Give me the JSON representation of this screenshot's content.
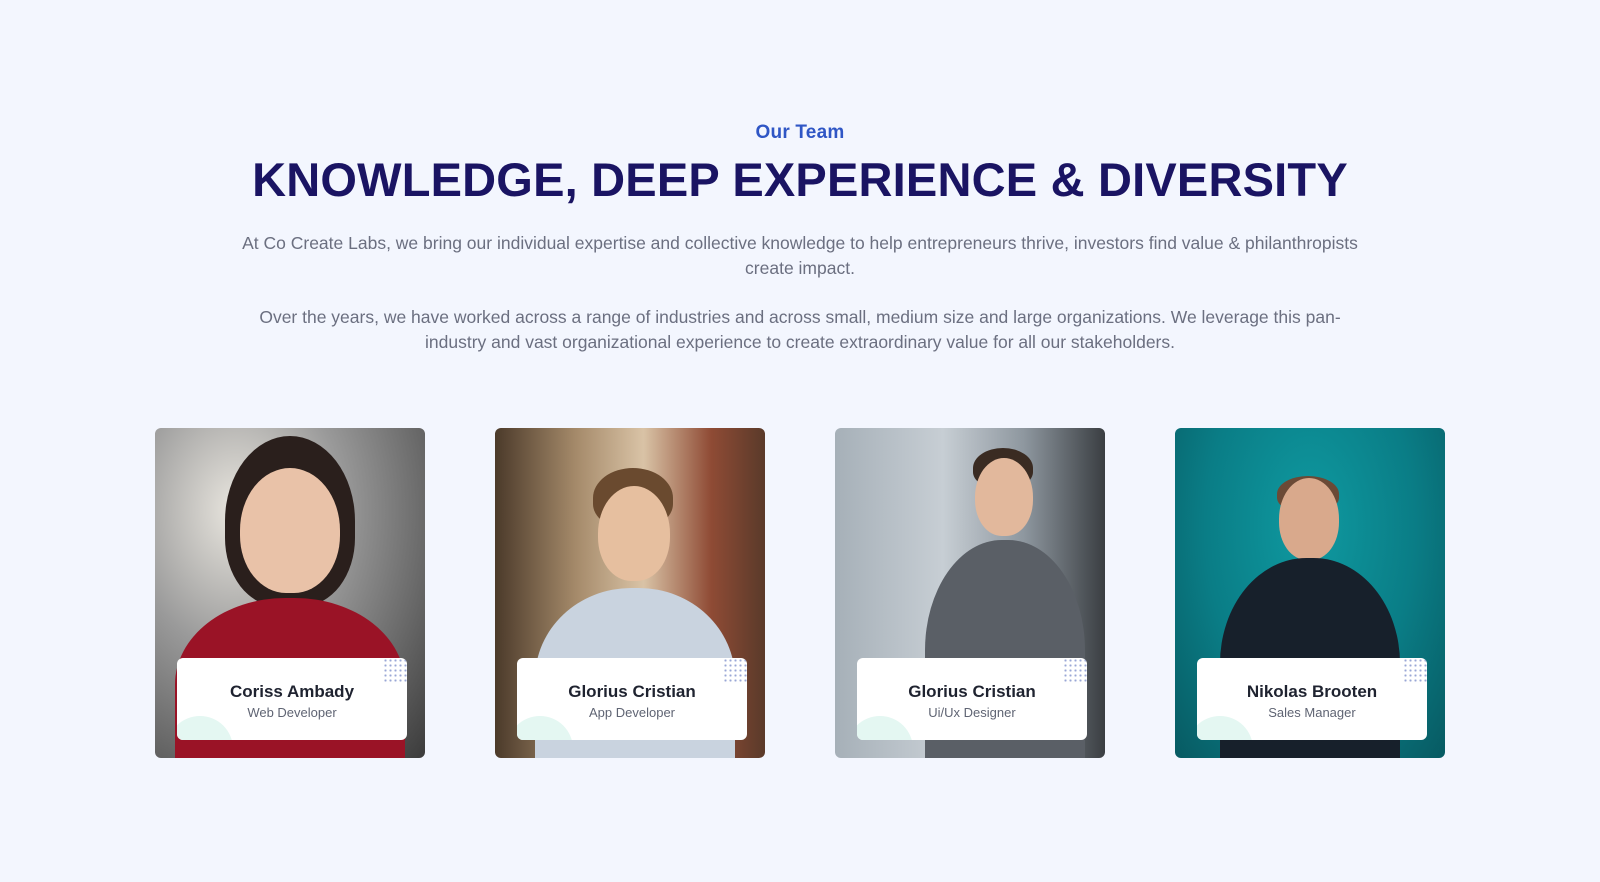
{
  "section": {
    "eyebrow": "Our Team",
    "headline": "KNOWLEDGE, DEEP EXPERIENCE & DIVERSITY",
    "paragraph_1": "At Co Create Labs, we bring our individual expertise and collective knowledge to help entrepreneurs thrive, investors find value & philanthropists create impact.",
    "paragraph_2": "Over the years,  we have worked across a range of industries and across small, medium size and large organizations. We leverage this pan-industry and vast organizational experience to create extraordinary value for all our stakeholders."
  },
  "team": [
    {
      "name": "Coriss Ambady",
      "role": "Web Developer"
    },
    {
      "name": "Glorius Cristian",
      "role": "App Developer"
    },
    {
      "name": "Glorius Cristian",
      "role": "Ui/Ux Designer"
    },
    {
      "name": "Nikolas Brooten",
      "role": "Sales Manager"
    }
  ],
  "colors": {
    "page_background": "#f3f6fe",
    "eyebrow": "#2f56c5",
    "headline": "#1a1463",
    "body_text": "#6b6f80"
  }
}
